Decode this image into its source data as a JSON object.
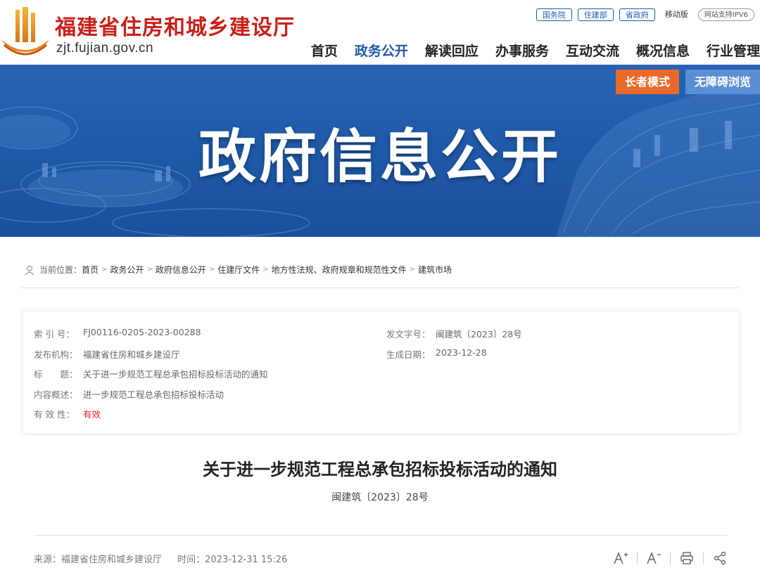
{
  "site": {
    "title": "福建省住房和城乡建设厅",
    "domain": "zjt.fujian.gov.cn"
  },
  "toplinks": [
    "国务院",
    "住建部",
    "省政府",
    "移动版",
    "网站支持IPV6"
  ],
  "nav": [
    "首页",
    "政务公开",
    "解读回应",
    "办事服务",
    "互动交流",
    "概况信息",
    "行业管理"
  ],
  "nav_active": "政务公开",
  "banner": {
    "title": "政府信息公开",
    "elder_mode": "长者模式",
    "accessible": "无障碍浏览"
  },
  "breadcrumb": {
    "prefix": "当前位置：",
    "items": [
      "首页",
      "政务公开",
      "政府信息公开",
      "住建厅文件",
      "地方性法规、政府规章和规范性文件",
      "建筑市场"
    ]
  },
  "info": {
    "index_label": "索 引 号：",
    "index_value": "FJ00116-0205-2023-00288",
    "doc_no_label": "发文字号：",
    "doc_no_value": "闽建筑〔2023〕28号",
    "publisher_label": "发布机构：",
    "publisher_value": "福建省住房和城乡建设厅",
    "date_label": "生成日期：",
    "date_value": "2023-12-28",
    "title_label": "标　　题：",
    "title_value": "关于进一步规范工程总承包招标投标活动的通知",
    "summary_label": "内容概述：",
    "summary_value": "进一步规范工程总承包招标投标活动",
    "validity_label": "有 效 性：",
    "validity_value": "有效"
  },
  "article": {
    "title": "关于进一步规范工程总承包招标投标活动的通知",
    "doc_no": "闽建筑〔2023〕28号"
  },
  "meta": {
    "source": "来源：福建省住房和城乡建设厅",
    "time": "时间：2023-12-31 15:26"
  },
  "colors": {
    "brand_red": "#c8201a",
    "nav_blue": "#1e5ca8",
    "elder_orange": "#e86a2b",
    "access_blue": "#5b8fd3"
  }
}
